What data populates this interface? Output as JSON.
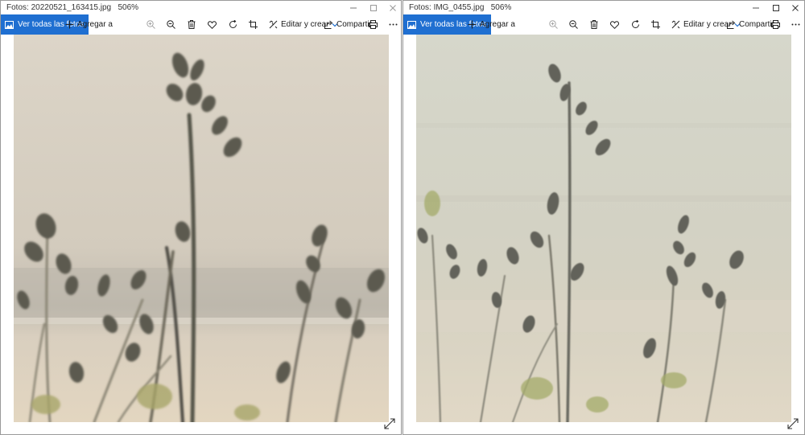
{
  "windows": [
    {
      "title": "Fotos: 20220521_163415.jpg",
      "zoom": "506%",
      "toolbar": {
        "view_all_label": "Ver todas las fotos",
        "add_to_label": "Agregar a",
        "edit_label": "Editar y crear",
        "share_label": "Compartir"
      },
      "photo_tone": "#d9d2c4"
    },
    {
      "title": "Fotos: IMG_0455.jpg",
      "zoom": "506%",
      "toolbar": {
        "view_all_label": "Ver todas las fotos",
        "add_to_label": "Agregar a",
        "edit_label": "Editar y crear",
        "share_label": "Compartir"
      },
      "photo_tone": "#d8d6c8"
    }
  ],
  "icons": {
    "view_all": "photos-icon",
    "add": "plus-icon",
    "zoom_in": "zoom-in-icon",
    "zoom_out": "zoom-out-icon",
    "delete": "trash-icon",
    "favorite": "heart-icon",
    "rotate": "rotate-icon",
    "crop": "crop-icon",
    "edit": "edit-icon",
    "share": "share-icon",
    "print": "print-icon",
    "more": "more-icon",
    "fullscreen": "expand-icon"
  },
  "colors": {
    "accent": "#1f6fd1"
  }
}
